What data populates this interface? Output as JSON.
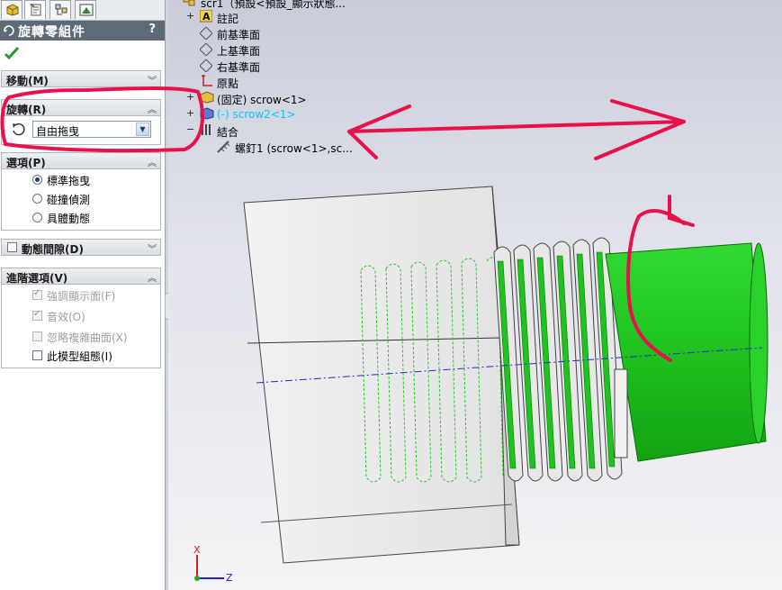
{
  "property_manager": {
    "tabs": [
      "feature-manager-icon",
      "property-manager-icon",
      "configuration-manager-icon",
      "dim-xpert-icon"
    ],
    "title": "旋轉零組件",
    "help": "?",
    "groups": {
      "move": {
        "label": "移動(M)"
      },
      "rotate": {
        "label": "旋轉(R)",
        "select_value": "自由拖曳"
      },
      "options": {
        "label": "選項(P)",
        "items": [
          "標準拖曳",
          "碰撞偵測",
          "具體動態"
        ],
        "selected": "標準拖曳"
      },
      "dynamic_clearance": {
        "label": "動態間隙(D)"
      },
      "advanced": {
        "label": "進階選項(V)",
        "items": [
          {
            "label": "強調顯示面(F)",
            "checked": true,
            "disabled": true
          },
          {
            "label": "音效(O)",
            "checked": true,
            "disabled": true
          },
          {
            "label": "忽略複雜曲面(X)",
            "checked": false,
            "disabled": true
          },
          {
            "label": "此模型組態(I)",
            "checked": false,
            "disabled": false
          }
        ]
      }
    }
  },
  "feature_tree": {
    "root": "scr1（預設<預設_顯示狀態...",
    "items": [
      {
        "label": "註記",
        "icon": "annotations-icon"
      },
      {
        "label": "前基準面",
        "icon": "plane-icon"
      },
      {
        "label": "上基準面",
        "icon": "plane-icon"
      },
      {
        "label": "右基準面",
        "icon": "plane-icon"
      },
      {
        "label": "原點",
        "icon": "origin-icon"
      },
      {
        "label": "(固定) scrow<1>",
        "icon": "part-icon"
      },
      {
        "label": "(-) scrow2<1>",
        "icon": "part-icon",
        "highlighted": true
      },
      {
        "label": "結合",
        "icon": "mates-icon"
      },
      {
        "label": "螺釘1 (scrow<1>,sc...",
        "icon": "screw-mate-icon"
      }
    ]
  },
  "triad": {
    "x_label": "X",
    "z_label": "Z"
  },
  "colors": {
    "title_bar": "#5d6a78",
    "part_green": "#1fc21f",
    "annotation_red": "#e8114a",
    "highlight_cyan": "#00c8ff"
  }
}
